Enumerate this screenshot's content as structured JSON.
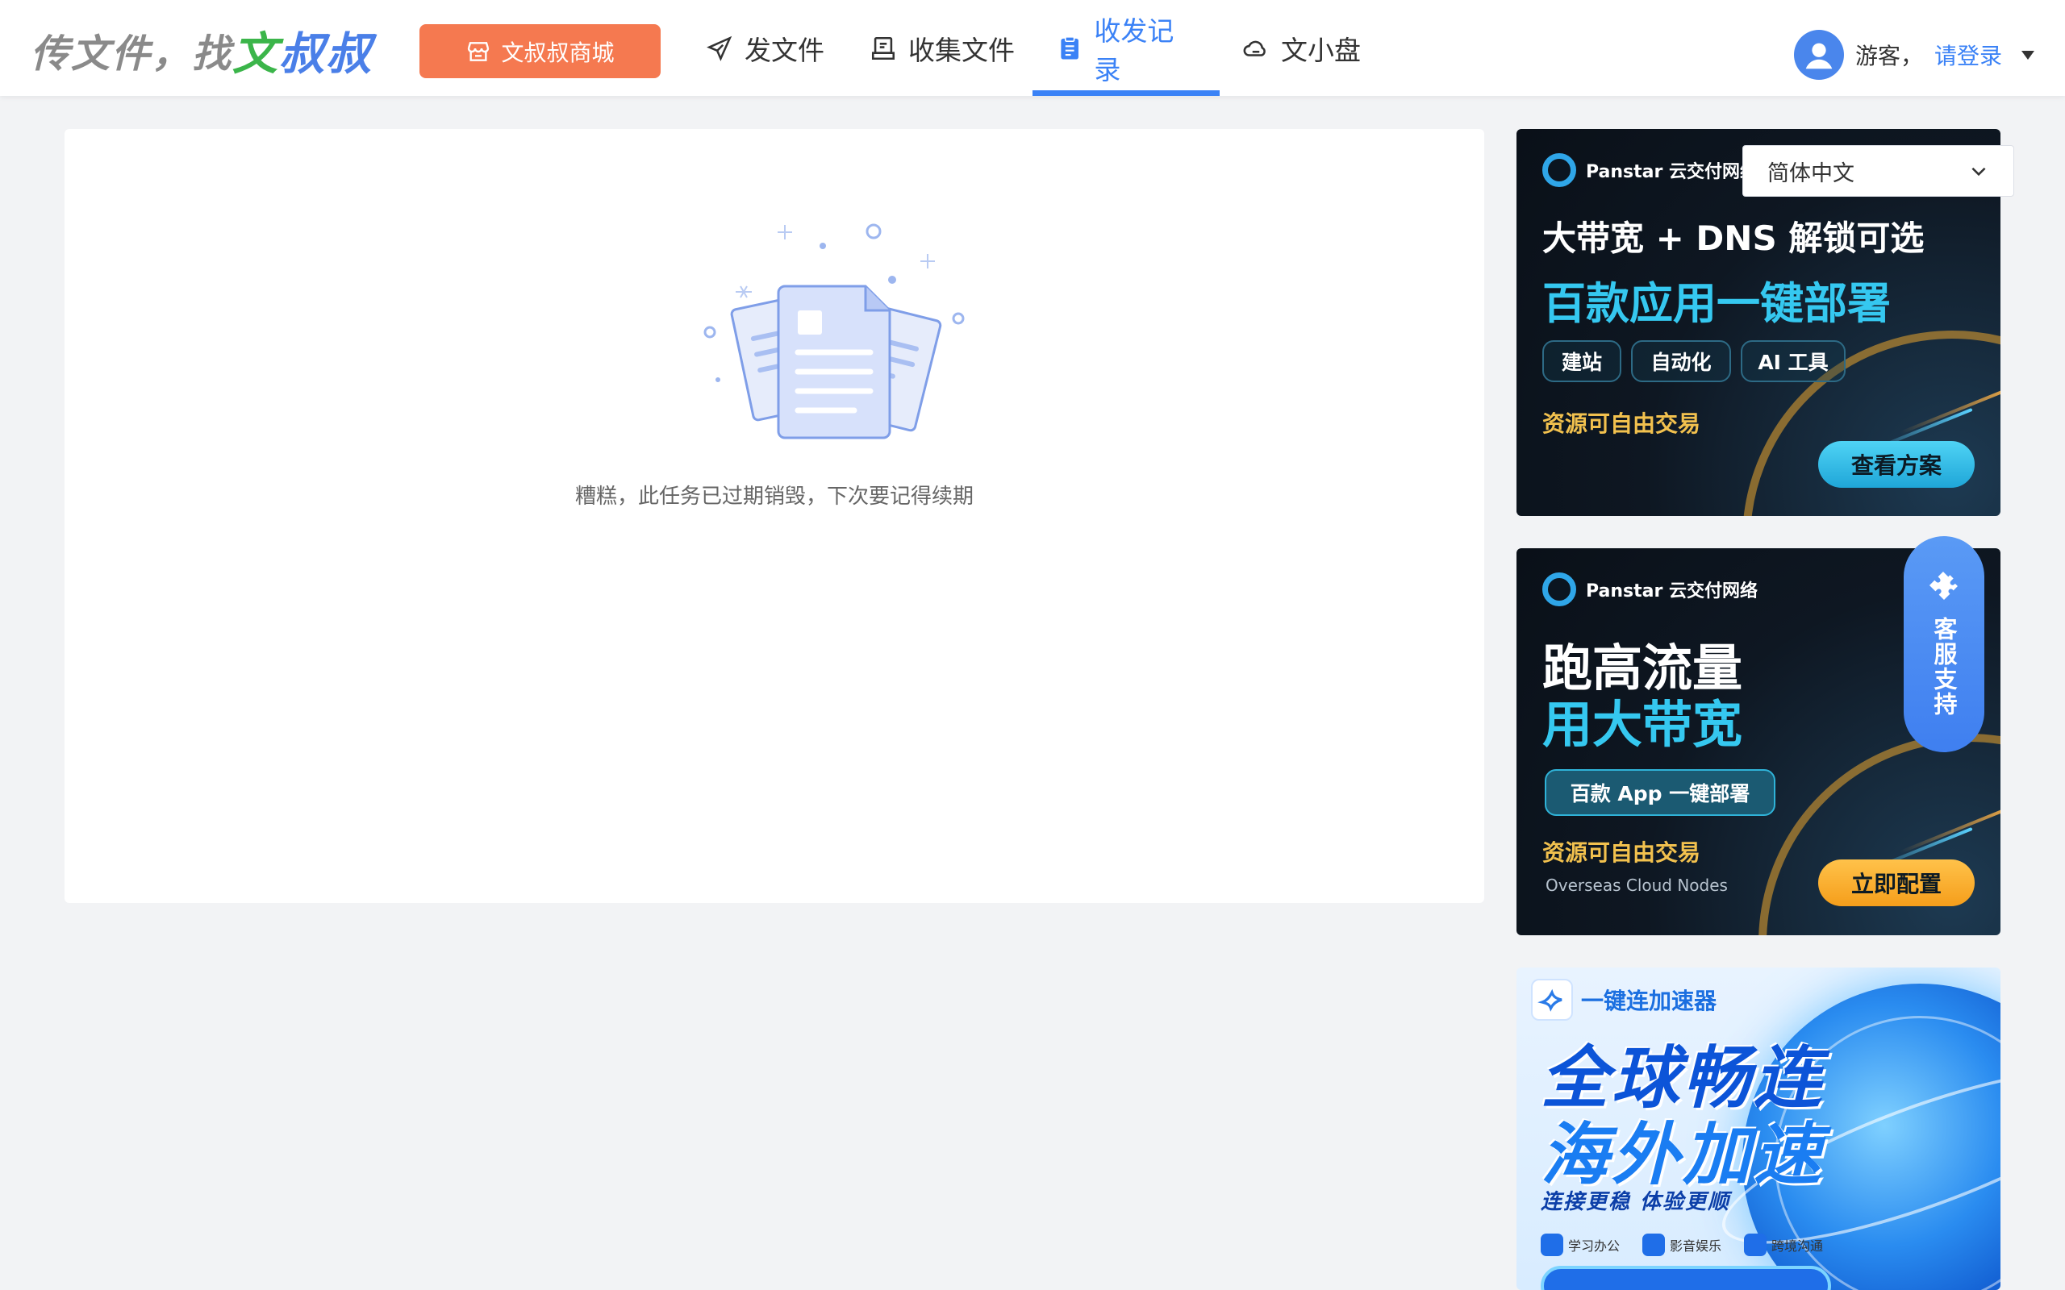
{
  "header": {
    "logo": {
      "prefix": "传文件，找",
      "brand_green": "文",
      "brand_blue": "叔叔"
    },
    "mall_button": "文叔叔商城",
    "nav": [
      {
        "label": "发文件",
        "icon": "paper-plane-icon",
        "active": false
      },
      {
        "label": "收集文件",
        "icon": "inbox-tray-icon",
        "active": false
      },
      {
        "label": "收发记录",
        "icon": "clipboard-icon",
        "active": true
      },
      {
        "label": "文小盘",
        "icon": "cloud-drive-icon",
        "active": false
      }
    ],
    "user": {
      "guest_label": "游客，",
      "login_label": "请登录"
    }
  },
  "main": {
    "empty_message": "糟糕，此任务已过期销毁，下次要记得续期"
  },
  "language": {
    "selected": "简体中文"
  },
  "support": {
    "label": "客服支持"
  },
  "ads": {
    "ad1": {
      "brand": "Panstar 云交付网络",
      "headline": "大带宽 + DNS 解锁可选",
      "subheadline": "百款应用一键部署",
      "tags": [
        "建站",
        "自动化",
        "AI 工具"
      ],
      "gold_text": "资源可自由交易",
      "cta": "查看方案"
    },
    "ad2": {
      "brand": "Panstar 云交付网络",
      "headline": "跑高流量",
      "subheadline": "用大带宽",
      "tag": "百款 App 一键部署",
      "gold_text": "资源可自由交易",
      "english_text": "Overseas Cloud Nodes",
      "cta": "立即配置"
    },
    "ad3": {
      "brand": "一键连加速器",
      "title_line1": "全球畅连",
      "title_line2": "海外加速",
      "slogan": "连接更稳  体验更顺",
      "features": [
        "学习办公",
        "影音娱乐",
        "跨境沟通"
      ]
    }
  },
  "colors": {
    "accent_blue": "#3b82f6",
    "mall_orange": "#f57950",
    "logo_green": "#3bb54a",
    "ad_gold": "#f2c14e",
    "ad_cyan": "#35c8f0"
  }
}
